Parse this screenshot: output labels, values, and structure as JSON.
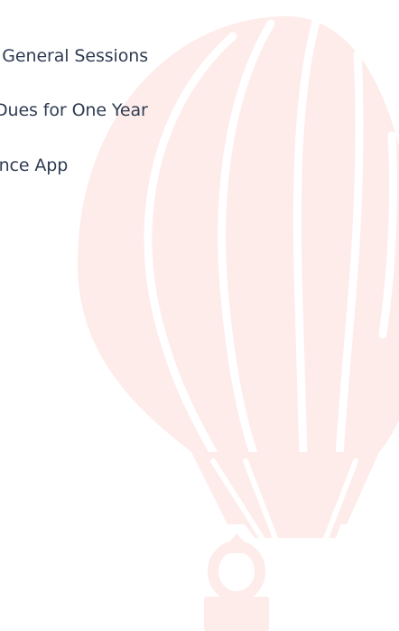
{
  "features": {
    "items": [
      {
        "label": "ll General Sessions"
      },
      {
        "label": " Dues for One Year"
      },
      {
        "label": "ence App"
      }
    ]
  },
  "colors": {
    "text": "#2f3c52",
    "balloon_tint": "#fdecea",
    "balloon_stripe": "#ffffff"
  },
  "icons": {
    "background": "hot-air-balloon-icon"
  }
}
